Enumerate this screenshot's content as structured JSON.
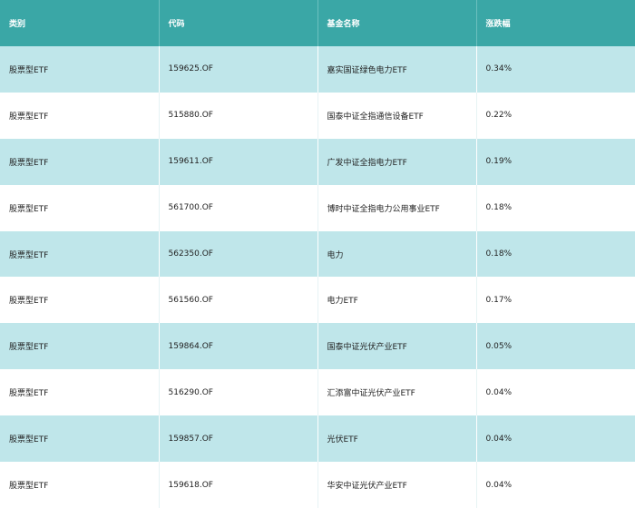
{
  "headers": {
    "category": "类别",
    "code": "代码",
    "name": "基金名称",
    "change": "涨跌幅"
  },
  "rows": [
    {
      "category": "股票型ETF",
      "code": "159625.OF",
      "name": "嘉实国证绿色电力ETF",
      "change": "0.34%"
    },
    {
      "category": "股票型ETF",
      "code": "515880.OF",
      "name": "国泰中证全指通信设备ETF",
      "change": "0.22%"
    },
    {
      "category": "股票型ETF",
      "code": "159611.OF",
      "name": "广发中证全指电力ETF",
      "change": "0.19%"
    },
    {
      "category": "股票型ETF",
      "code": "561700.OF",
      "name": "博时中证全指电力公用事业ETF",
      "change": "0.18%"
    },
    {
      "category": "股票型ETF",
      "code": "562350.OF",
      "name": "电力",
      "change": "0.18%"
    },
    {
      "category": "股票型ETF",
      "code": "561560.OF",
      "name": "电力ETF",
      "change": "0.17%"
    },
    {
      "category": "股票型ETF",
      "code": "159864.OF",
      "name": "国泰中证光伏产业ETF",
      "change": "0.05%"
    },
    {
      "category": "股票型ETF",
      "code": "516290.OF",
      "name": "汇添富中证光伏产业ETF",
      "change": "0.04%"
    },
    {
      "category": "股票型ETF",
      "code": "159857.OF",
      "name": "光伏ETF",
      "change": "0.04%"
    },
    {
      "category": "股票型ETF",
      "code": "159618.OF",
      "name": "华安中证光伏产业ETF",
      "change": "0.04%"
    }
  ],
  "colors": {
    "header_bg": "#3aa7a6",
    "stripe_bg": "#bfe6ea",
    "row_bg": "#ffffff"
  }
}
